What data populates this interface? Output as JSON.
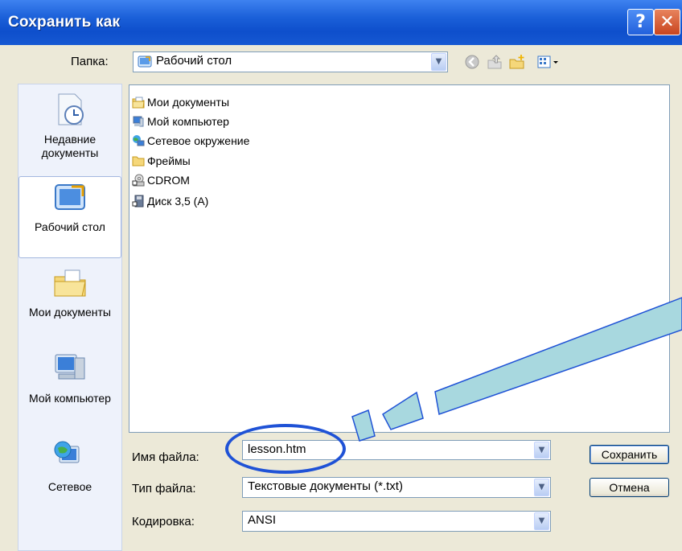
{
  "dialog": {
    "title": "Сохранить как",
    "help_label": "?",
    "close_label": "✕"
  },
  "folder": {
    "label": "Папка:",
    "value": "Рабочий стол"
  },
  "toolbar": [
    "back-icon",
    "up-folder-icon",
    "new-folder-icon",
    "view-menu-icon"
  ],
  "places": [
    {
      "label": "Недавние документы",
      "icon": "recent-documents-icon"
    },
    {
      "label": "Рабочий стол",
      "icon": "desktop-icon"
    },
    {
      "label": "Мои документы",
      "icon": "my-documents-icon"
    },
    {
      "label": "Мой компьютер",
      "icon": "my-computer-icon"
    },
    {
      "label": "Сетевое",
      "icon": "network-icon"
    }
  ],
  "files": [
    {
      "name": "Мои документы",
      "icon": "my-documents-folder-icon"
    },
    {
      "name": "Мой компьютер",
      "icon": "computer-icon"
    },
    {
      "name": "Сетевое окружение",
      "icon": "network-neighborhood-icon"
    },
    {
      "name": "Фреймы",
      "icon": "folder-icon"
    },
    {
      "name": "CDROM",
      "icon": "cdrom-shortcut-icon"
    },
    {
      "name": "Диск 3,5 (A)",
      "icon": "floppy-shortcut-icon"
    }
  ],
  "form": {
    "filename_label": "Имя файла:",
    "filename_value": "lesson.htm",
    "filetype_label": "Тип файла:",
    "filetype_value": "Текстовые документы (*.txt)",
    "encoding_label": "Кодировка:",
    "encoding_value": "ANSI"
  },
  "buttons": {
    "save": "Сохранить",
    "cancel": "Отмена"
  },
  "colors": {
    "title_bar": "#1a5fd8",
    "window_bg": "#ece9d8",
    "annotation": "#1f52d6",
    "callout_fill": "#a8d8df"
  }
}
